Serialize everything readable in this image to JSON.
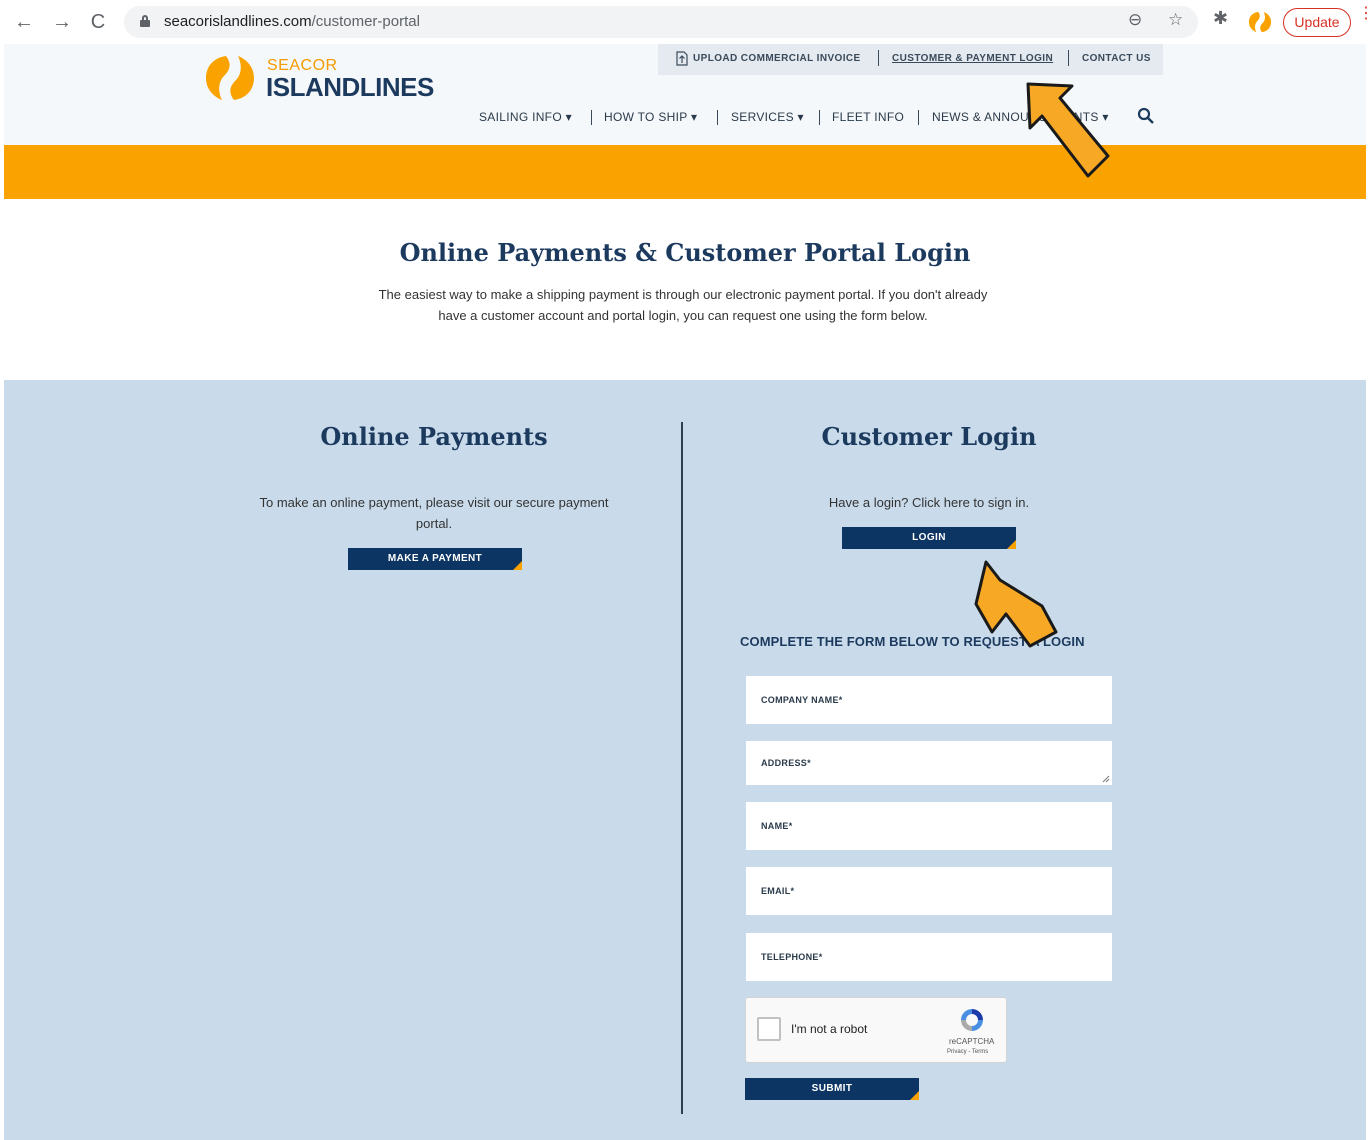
{
  "browser": {
    "url_domain": "seacorislandlines.com",
    "url_path": "/customer-portal",
    "update_label": "Update"
  },
  "header": {
    "logo_top": "SEACOR",
    "logo_bottom": "ISLANDLINES",
    "utility_links": [
      {
        "label": "UPLOAD COMMERCIAL INVOICE"
      },
      {
        "label": "CUSTOMER & PAYMENT LOGIN"
      },
      {
        "label": "CONTACT US"
      }
    ],
    "nav": [
      {
        "label": "SAILING INFO ▾"
      },
      {
        "label": "HOW TO SHIP ▾"
      },
      {
        "label": "SERVICES ▾"
      },
      {
        "label": "FLEET INFO"
      },
      {
        "label": "NEWS & ANNOUNCEMENTS ▾"
      }
    ]
  },
  "intro": {
    "title": "Online Payments & Customer Portal Login",
    "text": "The easiest way to make a shipping payment is through our electronic payment portal. If you don't already have a customer account and portal login, you can request one using the form below."
  },
  "payments": {
    "title": "Online Payments",
    "text": "To make an online payment, please visit our secure payment portal.",
    "button": "MAKE A PAYMENT"
  },
  "login": {
    "title": "Customer Login",
    "text": "Have a login? Click here to sign in.",
    "button": "LOGIN"
  },
  "form": {
    "heading": "COMPLETE THE FORM BELOW TO REQUEST A LOGIN",
    "fields": [
      {
        "label": "COMPANY NAME*"
      },
      {
        "label": "ADDRESS*"
      },
      {
        "label": "NAME*"
      },
      {
        "label": "EMAIL*"
      },
      {
        "label": "TELEPHONE*"
      }
    ],
    "captcha_label": "I'm not a robot",
    "captcha_brand": "reCAPTCHA",
    "captcha_terms": "Privacy - Terms",
    "submit": "SUBMIT"
  },
  "colors": {
    "brand_navy": "#0d3564",
    "brand_orange": "#f9a200",
    "section_blue": "#c9dbeb"
  }
}
